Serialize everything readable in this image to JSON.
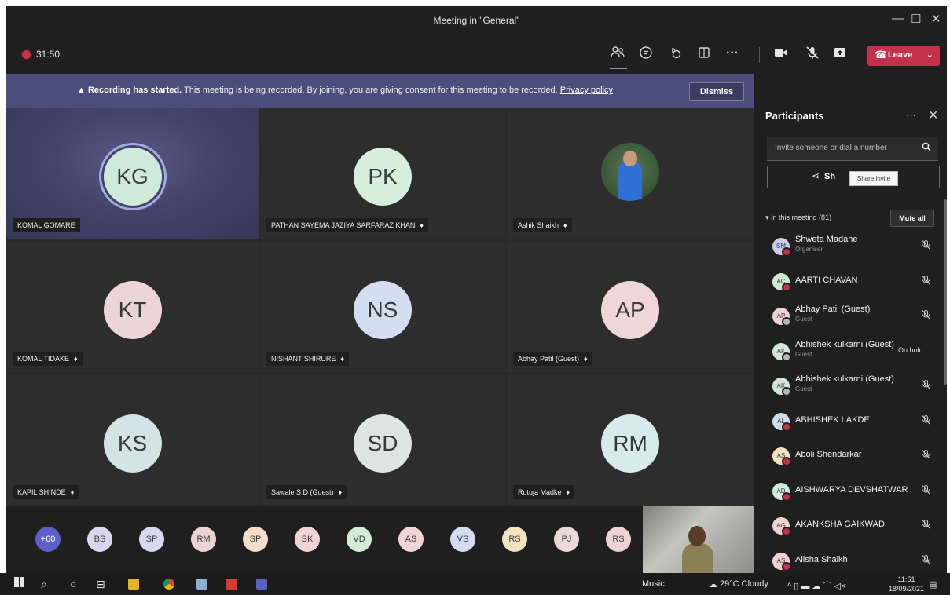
{
  "window": {
    "title": "Meeting in \"General\"",
    "minimize": "—",
    "maximize": "☐",
    "close": "✕"
  },
  "toolbar": {
    "timer": "31:50",
    "leave_label": "Leave"
  },
  "banner": {
    "bold": "Recording has started.",
    "text": " This meeting is being recorded. By joining, you are giving consent for this meeting to be recorded. ",
    "link": "Privacy policy",
    "dismiss": "Dismiss"
  },
  "tiles": [
    {
      "initials": "KG",
      "name": "KOMAL GOMARE",
      "color": "#cfead9",
      "muted": false,
      "speaking": true
    },
    {
      "initials": "PK",
      "name": "PATHAN SAYEMA JAZIYA SARFARAZ KHAN",
      "color": "#d6efdd",
      "muted": true
    },
    {
      "initials": "",
      "name": "Ashik Shaikh",
      "color": "",
      "muted": true,
      "photo": true
    },
    {
      "initials": "KT",
      "name": "KOMAL TIDAKE",
      "color": "#ecd5d8",
      "muted": true
    },
    {
      "initials": "NS",
      "name": "NISHANT SHIRURE",
      "color": "#d3def0",
      "muted": true
    },
    {
      "initials": "AP",
      "name": "Abhay Patil (Guest)",
      "color": "#efd7d9",
      "muted": true
    },
    {
      "initials": "KS",
      "name": "KAPIL SHINDE",
      "color": "#d4e3e5",
      "muted": true
    },
    {
      "initials": "SD",
      "name": "Sawale S D (Guest)",
      "color": "#dde5e3",
      "muted": true
    },
    {
      "initials": "RM",
      "name": "Rutuja Madke",
      "color": "#d7ecea",
      "muted": true
    }
  ],
  "strip": [
    {
      "initials": "+60",
      "color": "#5b5fc7",
      "more": true
    },
    {
      "initials": "BS",
      "color": "#d9d7ef"
    },
    {
      "initials": "SP",
      "color": "#d7d9f2"
    },
    {
      "initials": "RM",
      "color": "#ecd3d5"
    },
    {
      "initials": "SP",
      "color": "#f4dec7"
    },
    {
      "initials": "SK",
      "color": "#f1d3d5"
    },
    {
      "initials": "VD",
      "color": "#d2ecd8"
    },
    {
      "initials": "AS",
      "color": "#f1d6d8"
    },
    {
      "initials": "VS",
      "color": "#d3dcf2"
    },
    {
      "initials": "RS",
      "color": "#f3e3bf"
    },
    {
      "initials": "PJ",
      "color": "#ecd7d9"
    },
    {
      "initials": "RS",
      "color": "#f1d3d5"
    }
  ],
  "panel": {
    "title": "Participants",
    "invite_placeholder": "Invite someone or dial a number",
    "share_label": "Share invite",
    "share_visible": "Sh",
    "tooltip": "Share invite",
    "in_meeting": "In this meeting (81)",
    "mute_all": "Mute all",
    "participants": [
      {
        "initials": "SM",
        "name": "Shweta Madane",
        "role": "Organiser",
        "color": "#c9cdf0",
        "status": "red",
        "state": "muted"
      },
      {
        "initials": "AC",
        "name": "AARTI CHAVAN",
        "role": "",
        "color": "#cde9d6",
        "status": "red",
        "state": "muted"
      },
      {
        "initials": "AP",
        "name": "Abhay Patil (Guest)",
        "role": "Guest",
        "color": "#efd2d5",
        "status": "grey",
        "state": "muted"
      },
      {
        "initials": "AK",
        "name": "Abhishek kulkarni (Guest)",
        "role": "Guest",
        "color": "#d4e6dc",
        "status": "grey",
        "state": "On hold"
      },
      {
        "initials": "AK",
        "name": "Abhishek kulkarni (Guest)",
        "role": "Guest",
        "color": "#d4e6dc",
        "status": "grey",
        "state": "muted"
      },
      {
        "initials": "AL",
        "name": "ABHISHEK LAKDE",
        "role": "",
        "color": "#cfdcf2",
        "status": "red",
        "state": "muted"
      },
      {
        "initials": "AS",
        "name": "Aboli Shendarkar",
        "role": "",
        "color": "#f3e2bd",
        "status": "red",
        "state": "muted"
      },
      {
        "initials": "AD",
        "name": "AISHWARYA DEVSHATWAR",
        "role": "",
        "color": "#cfebdb",
        "status": "red",
        "state": "muted"
      },
      {
        "initials": "AG",
        "name": "AKANKSHA GAIKWAD",
        "role": "",
        "color": "#f0d2d5",
        "status": "red",
        "state": "muted"
      },
      {
        "initials": "AS",
        "name": "Alisha Shaikh",
        "role": "",
        "color": "#f0d2d5",
        "status": "red",
        "state": "muted"
      }
    ]
  },
  "taskbar": {
    "music": "Music",
    "weather": "29°C  Cloudy",
    "time": "11:51",
    "date": "18/09/2021"
  }
}
